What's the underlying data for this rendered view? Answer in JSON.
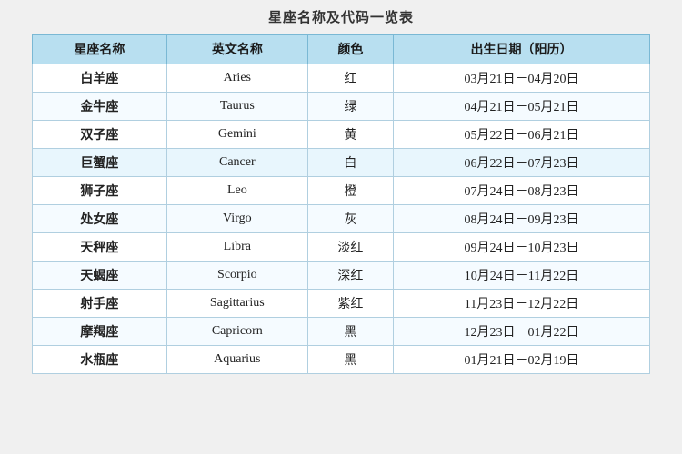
{
  "title": "星座名称及代码一览表",
  "table": {
    "headers": [
      "星座名称",
      "英文名称",
      "颜色",
      "出生日期（阳历）"
    ],
    "rows": [
      {
        "cn": "白羊座",
        "en": "Aries",
        "color": "红",
        "date": "03月21日－04月20日"
      },
      {
        "cn": "金牛座",
        "en": "Taurus",
        "color": "绿",
        "date": "04月21日－05月21日"
      },
      {
        "cn": "双子座",
        "en": "Gemini",
        "color": "黄",
        "date": "05月22日－06月21日"
      },
      {
        "cn": "巨蟹座",
        "en": "Cancer",
        "color": "白",
        "date": "06月22日－07月23日"
      },
      {
        "cn": "狮子座",
        "en": "Leo",
        "color": "橙",
        "date": "07月24日－08月23日"
      },
      {
        "cn": "处女座",
        "en": "Virgo",
        "color": "灰",
        "date": "08月24日－09月23日"
      },
      {
        "cn": "天秤座",
        "en": "Libra",
        "color": "淡红",
        "date": "09月24日－10月23日"
      },
      {
        "cn": "天蝎座",
        "en": "Scorpio",
        "color": "深红",
        "date": "10月24日－11月22日"
      },
      {
        "cn": "射手座",
        "en": "Sagittarius",
        "color": "紫红",
        "date": "11月23日－12月22日"
      },
      {
        "cn": "摩羯座",
        "en": "Capricorn",
        "color": "黑",
        "date": "12月23日－01月22日"
      },
      {
        "cn": "水瓶座",
        "en": "Aquarius",
        "color": "黑",
        "date": "01月21日－02月19日"
      }
    ]
  }
}
